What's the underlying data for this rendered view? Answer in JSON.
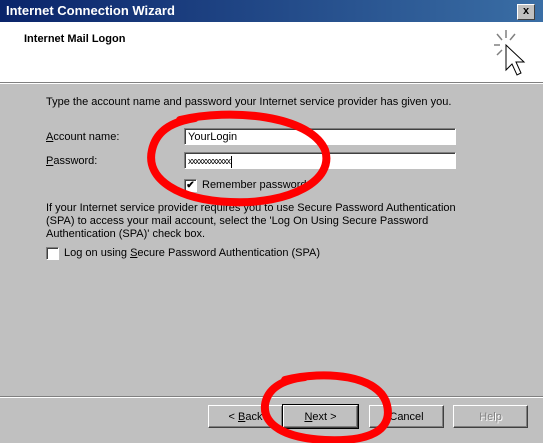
{
  "window": {
    "title": "Internet Connection Wizard",
    "close_label": "x"
  },
  "header": {
    "title": "Internet Mail Logon",
    "icon": "wizard-sparkle-cursor-icon"
  },
  "intro_text": "Type the account name and password your Internet service provider has given you.",
  "account": {
    "label_pre": "",
    "label_u": "A",
    "label_post": "ccount name:",
    "value": "YourLogin"
  },
  "password": {
    "label_pre": "",
    "label_u": "P",
    "label_post": "assword:",
    "value": "xxxxxxxxxxxx"
  },
  "remember": {
    "label": "Remember password",
    "checked": true
  },
  "spa": {
    "text": "If your Internet service provider requires you to use Secure Password Authentication (SPA) to access your mail account, select the 'Log On Using Secure Password Authentication (SPA)' check box.",
    "checkbox_pre": "Log on using ",
    "checkbox_u": "S",
    "checkbox_post": "ecure Password Authentication (SPA)",
    "checked": false
  },
  "buttons": {
    "back": {
      "pre": "< ",
      "u": "B",
      "post": "ack"
    },
    "next": {
      "pre": "",
      "u": "N",
      "post": "ext >"
    },
    "cancel": "Cancel",
    "help": "Help"
  },
  "annotation_color": "#ff0000"
}
